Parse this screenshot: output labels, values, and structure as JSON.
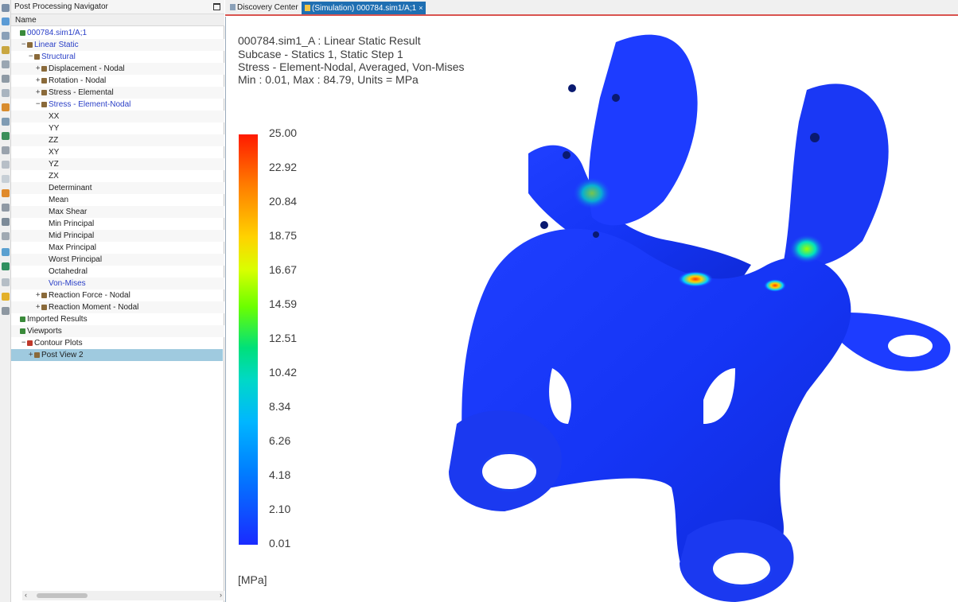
{
  "navigator": {
    "title": "Post Processing Navigator",
    "column_header": "Name",
    "tree": [
      {
        "label": "000784.sim1/A;1",
        "level": 0,
        "blue": true
      },
      {
        "label": "Linear Static",
        "level": 1,
        "blue": true,
        "twisty": "−"
      },
      {
        "label": "Structural",
        "level": 2,
        "blue": true,
        "twisty": "−"
      },
      {
        "label": "Displacement - Nodal",
        "level": 3,
        "blue": false,
        "twisty": "+"
      },
      {
        "label": "Rotation - Nodal",
        "level": 3,
        "blue": false,
        "twisty": "+"
      },
      {
        "label": "Stress - Elemental",
        "level": 3,
        "blue": false,
        "twisty": "+"
      },
      {
        "label": "Stress - Element-Nodal",
        "level": 3,
        "blue": true,
        "twisty": "−"
      },
      {
        "label": "XX",
        "level": 4,
        "blue": false
      },
      {
        "label": "YY",
        "level": 4,
        "blue": false
      },
      {
        "label": "ZZ",
        "level": 4,
        "blue": false
      },
      {
        "label": "XY",
        "level": 4,
        "blue": false
      },
      {
        "label": "YZ",
        "level": 4,
        "blue": false
      },
      {
        "label": "ZX",
        "level": 4,
        "blue": false
      },
      {
        "label": "Determinant",
        "level": 4,
        "blue": false
      },
      {
        "label": "Mean",
        "level": 4,
        "blue": false
      },
      {
        "label": "Max Shear",
        "level": 4,
        "blue": false
      },
      {
        "label": "Min Principal",
        "level": 4,
        "blue": false
      },
      {
        "label": "Mid Principal",
        "level": 4,
        "blue": false
      },
      {
        "label": "Max Principal",
        "level": 4,
        "blue": false
      },
      {
        "label": "Worst Principal",
        "level": 4,
        "blue": false
      },
      {
        "label": "Octahedral",
        "level": 4,
        "blue": false
      },
      {
        "label": "Von-Mises",
        "level": 4,
        "blue": true
      },
      {
        "label": "Reaction Force - Nodal",
        "level": 3,
        "blue": false,
        "twisty": "+"
      },
      {
        "label": "Reaction Moment - Nodal",
        "level": 3,
        "blue": false,
        "twisty": "+"
      },
      {
        "label": "Imported Results",
        "level": 0,
        "blue": false
      },
      {
        "label": "Viewports",
        "level": 0,
        "blue": false
      },
      {
        "label": "Contour Plots",
        "level": 1,
        "blue": false,
        "twisty": "−"
      },
      {
        "label": "Post View 2",
        "level": 2,
        "blue": false,
        "twisty": "+",
        "selected": true
      }
    ]
  },
  "tabs": {
    "discovery": "Discovery Center",
    "simulation": "(Simulation) 000784.sim1/A;1"
  },
  "viewport": {
    "info": [
      "000784.sim1_A : Linear Static Result",
      "Subcase - Statics 1, Static Step 1",
      "Stress - Element-Nodal, Averaged, Von-Mises",
      "Min : 0.01, Max : 84.79, Units = MPa"
    ],
    "legend_labels": [
      "25.00",
      "22.92",
      "20.84",
      "18.75",
      "16.67",
      "14.59",
      "12.51",
      "10.42",
      "8.34",
      "6.26",
      "4.18",
      "2.10",
      "0.01"
    ],
    "legend_units": "[MPa]",
    "colors": {
      "low": "#1a2bff",
      "high": "#ff1a00",
      "accent": "#d9534f",
      "selection": "#9fcadf"
    }
  }
}
